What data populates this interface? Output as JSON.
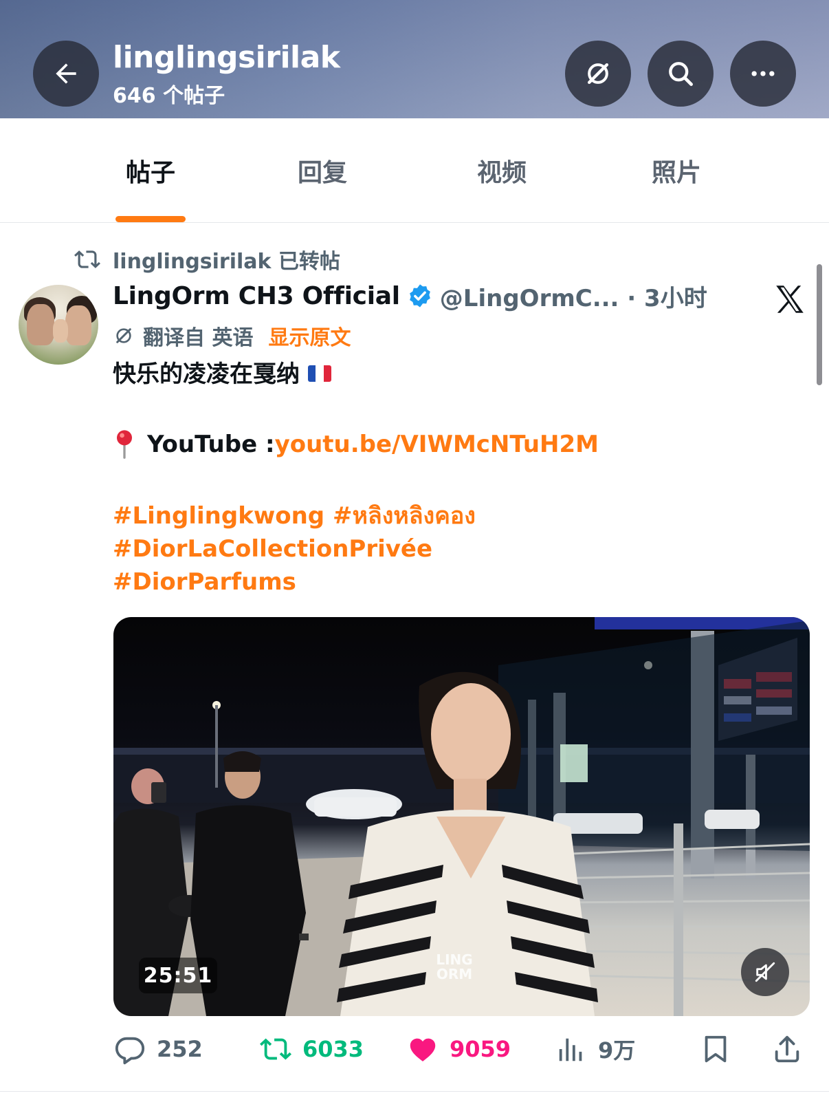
{
  "header": {
    "title": "linglingsirilak",
    "post_count": "646 个帖子",
    "buttons": [
      "back-arrow-icon",
      "grok-icon",
      "search-icon",
      "more-icon"
    ]
  },
  "tabs": [
    {
      "label": "帖子",
      "active": true
    },
    {
      "label": "回复",
      "active": false
    },
    {
      "label": "视频",
      "active": false
    },
    {
      "label": "照片",
      "active": false
    }
  ],
  "tweet": {
    "repost_label": "linglingsirilak 已转帖",
    "author": {
      "display_name": "LingOrm CH3 Official",
      "handle_time": "@LingOrmC... · 3小时",
      "verified": true
    },
    "translation": {
      "label": "翻译自 英语",
      "show_original": "显示原文"
    },
    "text_line1": "快乐的凌凌在戛纳",
    "youtube_label": "YouTube : ",
    "youtube_link": "youtu.be/VIWMcNTuH2M",
    "hashtags_line1": "#Linglingkwong #หลิงหลิงคอง",
    "hashtags_line2": "#DiorLaCollectionPrivée",
    "hashtags_line3": "#DiorParfums",
    "video": {
      "duration": "25:51",
      "watermark": "LING ORM"
    },
    "stats": {
      "replies": "252",
      "reposts": "6033",
      "likes": "9059",
      "views": "9万"
    }
  },
  "colors": {
    "accent": "#ff7a12",
    "retweet": "#00ba7c",
    "like": "#f91880",
    "verified": "#1d9bf0",
    "muted": "#536471"
  }
}
